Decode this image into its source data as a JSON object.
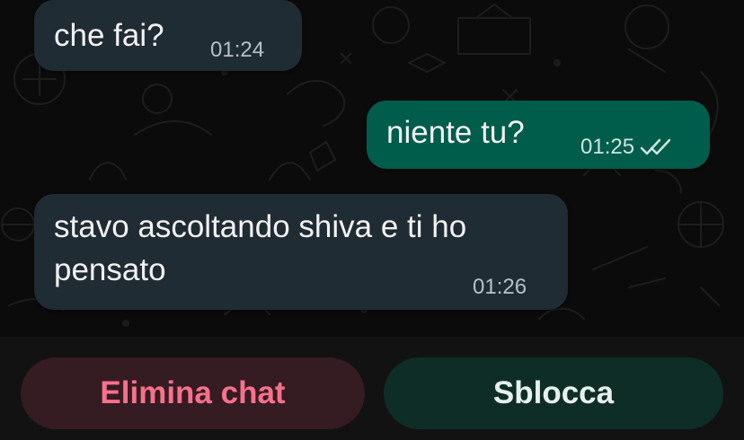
{
  "chat": {
    "messages": [
      {
        "direction": "incoming",
        "text": "che fai?",
        "time": "01:24"
      },
      {
        "direction": "outgoing",
        "text": "niente tu?",
        "time": "01:25",
        "status_icon": "double-check-icon"
      },
      {
        "direction": "incoming",
        "text_lines": [
          "stavo ascoltando shiva e ti ho",
          "pensato"
        ],
        "time": "01:26"
      }
    ]
  },
  "actions": {
    "delete_label": "Elimina chat",
    "unblock_label": "Sblocca"
  },
  "colors": {
    "background": "#0b0b0b",
    "incoming_bubble": "#202c33",
    "outgoing_bubble": "#005c4b",
    "delete_button_bg": "#351b22",
    "delete_button_text": "#f7718c",
    "unblock_button_bg": "#0f2d27",
    "unblock_button_text": "#e7f1ec"
  }
}
